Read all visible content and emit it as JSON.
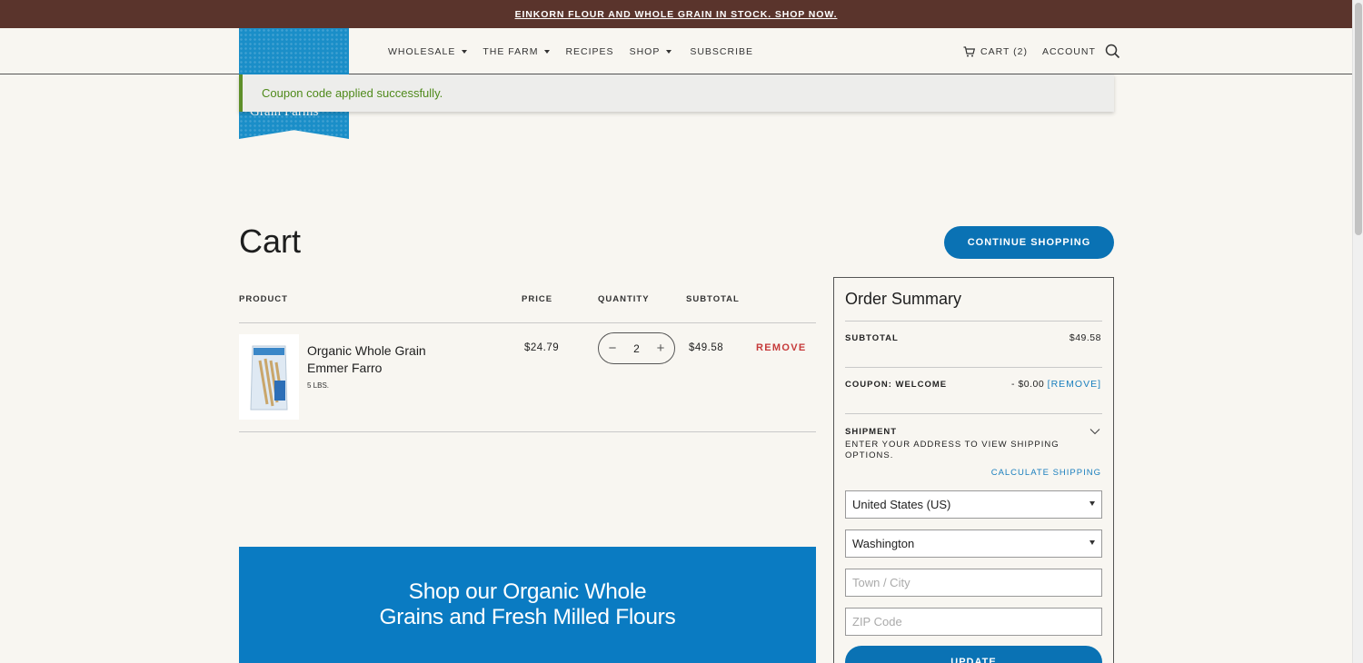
{
  "announcement": {
    "text": "EINKORN FLOUR AND WHOLE GRAIN IN STOCK. SHOP NOW."
  },
  "logo": {
    "text": "Grain Farms"
  },
  "nav": {
    "items": [
      {
        "label": "WHOLESALE",
        "has_dropdown": true
      },
      {
        "label": "THE FARM",
        "has_dropdown": true
      },
      {
        "label": "RECIPES",
        "has_dropdown": false
      },
      {
        "label": "SHOP",
        "has_dropdown": true
      },
      {
        "label": "SUBSCRIBE",
        "has_dropdown": false
      }
    ],
    "cart_label": "CART (2)",
    "account_label": "ACCOUNT",
    "search_icon": "search-icon"
  },
  "notice": {
    "message": "Coupon code applied successfully.",
    "color": "#4f8a1b"
  },
  "cart": {
    "title": "Cart",
    "continue_label": "CONTINUE SHOPPING",
    "columns": {
      "product": "PRODUCT",
      "price": "PRICE",
      "quantity": "QUANTITY",
      "subtotal": "SUBTOTAL"
    },
    "items": [
      {
        "name": "Organic Whole Grain Emmer Farro",
        "variant": "5 LBS.",
        "price": "$24.79",
        "quantity": "2",
        "subtotal": "$49.58",
        "remove_label": "REMOVE"
      }
    ]
  },
  "promo": {
    "line1": "Shop our Organic Whole",
    "line2": "Grains and Fresh Milled Flours"
  },
  "summary": {
    "title": "Order Summary",
    "subtotal_label": "SUBTOTAL",
    "subtotal_value": "$49.58",
    "coupon_label": "COUPON: WELCOME",
    "coupon_value": "- $0.00",
    "coupon_remove": "[REMOVE]",
    "shipment_label": "SHIPMENT",
    "shipment_note": "ENTER YOUR ADDRESS TO VIEW SHIPPING OPTIONS.",
    "calculate_label": "CALCULATE SHIPPING",
    "country_value": "United States (US)",
    "state_value": "Washington",
    "city_placeholder": "Town / City",
    "zip_placeholder": "ZIP Code",
    "update_label": "UPDATE"
  },
  "colors": {
    "brand_blue": "#0a72b4",
    "announce_bg": "#5a342c",
    "remove_red": "#c63a3a",
    "page_bg": "#f8f6f1"
  }
}
